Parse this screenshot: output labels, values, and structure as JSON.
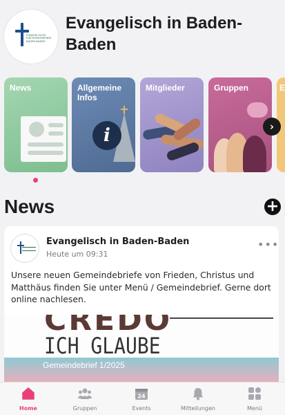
{
  "header": {
    "title": "Evangelisch in Baden-Baden",
    "logo_text": "EVANGELISCHE KIRCHENGEMEINDE BADEN-BADEN"
  },
  "categories": [
    {
      "label": "News",
      "color": "#8fca9f"
    },
    {
      "label": "Allgemeine Infos",
      "color": "#5b7aa6"
    },
    {
      "label": "Mitglieder",
      "color": "#a295cc"
    },
    {
      "label": "Gruppen",
      "color": "#b95f8f"
    },
    {
      "label": "E",
      "color": "#f3c77a"
    }
  ],
  "news_section": {
    "heading": "News",
    "add_icon": "plus-circle-icon"
  },
  "post": {
    "author": "Evangelisch in Baden-Baden",
    "time": "Heute um 09:31",
    "text": "Unsere neuen Gemeindebriefe von Frieden, Christus und Matthäus finden Sie unter Menü / Gemeindebrief. Gerne dort online nachlesen.",
    "image_text_1": "CREDO",
    "image_text_2": "ICH GLAUBE",
    "image_text_3": "Gemeindebrief 1/2025"
  },
  "tabs": [
    {
      "label": "Home",
      "icon": "home-icon",
      "active": true
    },
    {
      "label": "Gruppen",
      "icon": "group-icon",
      "active": false
    },
    {
      "label": "Events",
      "icon": "calendar-icon",
      "active": false,
      "icon_text": "24"
    },
    {
      "label": "Mitteilungen",
      "icon": "bell-icon",
      "active": false
    },
    {
      "label": "Menü",
      "icon": "grid-icon",
      "active": false
    }
  ],
  "colors": {
    "accent": "#e8407a",
    "background": "#f2f2f4"
  }
}
